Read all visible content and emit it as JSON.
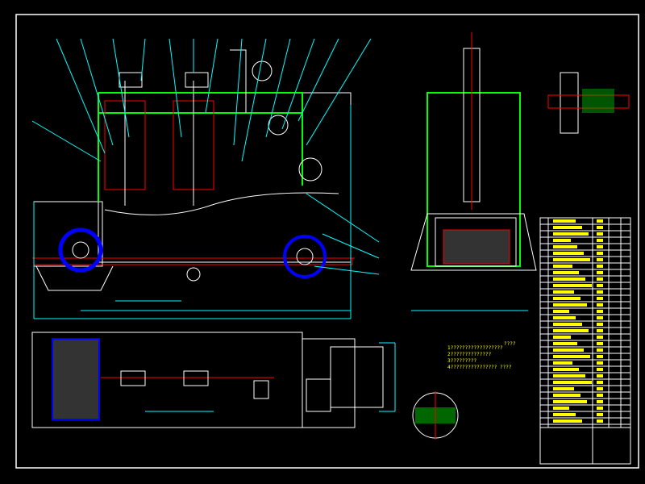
{
  "colors": {
    "background": "#000000",
    "outline": "#ffffff",
    "dimension": "#00ffff",
    "frame": "#00ff00",
    "hidden": "#ff0000",
    "blue": "#0000ff",
    "text": "#ffff00",
    "magenta": "#ff00ff"
  },
  "notes": {
    "heading": "????",
    "lines": [
      "1??????????????????",
      "2??????????????",
      "3?????????",
      "4???????????????? ????"
    ]
  }
}
